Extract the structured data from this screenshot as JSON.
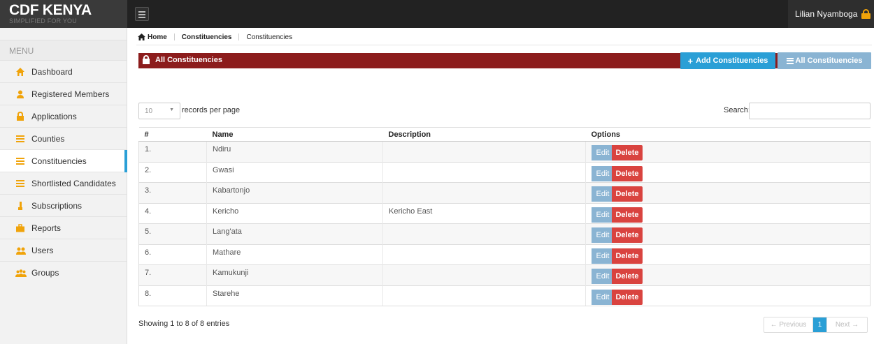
{
  "brand": {
    "title": "CDF KENYA",
    "subtitle": "SIMPLIFIED FOR YOU"
  },
  "user": {
    "name": "Lilian Nyamboga",
    "icon": "lock-icon"
  },
  "sidebar": {
    "menu_label": "MENU",
    "items": [
      {
        "label": "Dashboard",
        "icon": "home-icon"
      },
      {
        "label": "Registered Members",
        "icon": "user-icon"
      },
      {
        "label": "Applications",
        "icon": "lock-icon"
      },
      {
        "label": "Counties",
        "icon": "list-icon"
      },
      {
        "label": "Constituencies",
        "icon": "list-icon",
        "active": true
      },
      {
        "label": "Shortlisted Candidates",
        "icon": "list-icon"
      },
      {
        "label": "Subscriptions",
        "icon": "bulb-icon"
      },
      {
        "label": "Reports",
        "icon": "briefcase-icon"
      },
      {
        "label": "Users",
        "icon": "users-icon"
      },
      {
        "label": "Groups",
        "icon": "group-icon"
      }
    ]
  },
  "breadcrumb": {
    "home": "Home",
    "section": "Constituencies",
    "page": "Constituencies"
  },
  "panel": {
    "title": "All Constituencies",
    "add_label": "Add Constituencies",
    "all_label": "All Constituencies"
  },
  "controls": {
    "page_length": "10",
    "page_length_label": "records per page",
    "search_label": "Search:"
  },
  "table": {
    "headers": {
      "num": "#",
      "name": "Name",
      "description": "Description",
      "options": "Options"
    },
    "edit_label": "Edit",
    "delete_label": "Delete",
    "rows": [
      {
        "num": "1.",
        "name": "Ndiru",
        "description": ""
      },
      {
        "num": "2.",
        "name": "Gwasi",
        "description": ""
      },
      {
        "num": "3.",
        "name": "Kabartonjo",
        "description": ""
      },
      {
        "num": "4.",
        "name": "Kericho",
        "description": "Kericho East"
      },
      {
        "num": "5.",
        "name": "Lang'ata",
        "description": ""
      },
      {
        "num": "6.",
        "name": "Mathare",
        "description": ""
      },
      {
        "num": "7.",
        "name": "Kamukunji",
        "description": ""
      },
      {
        "num": "8.",
        "name": "Starehe",
        "description": ""
      }
    ]
  },
  "footer": {
    "info": "Showing 1 to 8 of 8 entries",
    "prev": "← Previous",
    "current_page": "1",
    "next": "Next →"
  },
  "colors": {
    "topbar": "#222222",
    "panel_header": "#8c1c1c",
    "accent": "#2a9fd6",
    "edit": "#8ab4d3",
    "delete": "#d9433f",
    "icon_orange": "#f0a30a"
  }
}
